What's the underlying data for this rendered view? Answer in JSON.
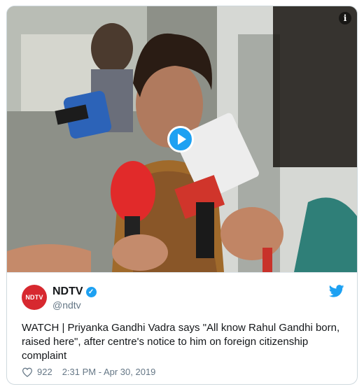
{
  "tweet": {
    "author": {
      "display_name": "NDTV",
      "handle": "@ndtv",
      "avatar_text": "NDTV",
      "verified": true
    },
    "text": "WATCH | Priyanka Gandhi Vadra says \"All know Rahul Gandhi born, raised here\", after centre's notice to him on foreign citizenship complaint",
    "likes": "922",
    "timestamp": "2:31 PM - Apr 30, 2019"
  },
  "media": {
    "type": "video",
    "info_icon": "info-icon",
    "play_icon": "play-icon"
  },
  "colors": {
    "accent": "#1da1f2",
    "brand_red": "#d7282f",
    "text_secondary": "#657786"
  },
  "icons": {
    "verified": "verified-badge-icon",
    "twitter": "twitter-bird-icon",
    "like": "heart-icon"
  }
}
